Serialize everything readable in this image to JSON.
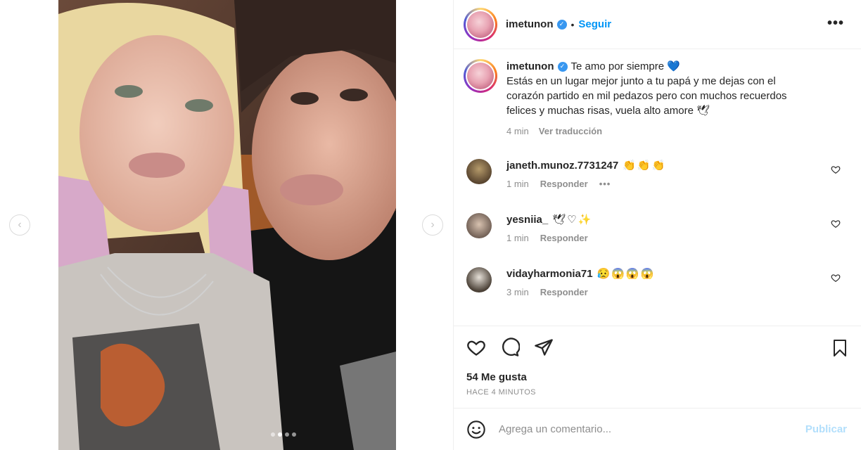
{
  "post": {
    "username": "imetunon",
    "separator": "•",
    "follow_label": "Seguir",
    "more_label": "•••",
    "verified_symbol": "✓"
  },
  "caption": {
    "username": "imetunon",
    "first_line": "Te amo por siempre",
    "heart_emoji": "💙",
    "line2": "Estás en un lugar mejor junto a tu papá y me dejas con el",
    "line3": "corazón partido en mil pedazos pero con muchos recuerdos",
    "line4": "felices y muchas risas, vuela alto amore",
    "line4_emoji": "🕊",
    "time": "4 min",
    "translate_label": "Ver traducción"
  },
  "comments": [
    {
      "username": "janeth.munoz.7731247",
      "emoji": "👏👏👏",
      "time": "1 min",
      "reply_label": "Responder",
      "more": "•••"
    },
    {
      "username": "yesniia_",
      "emoji": "🕊♡✨",
      "time": "1 min",
      "reply_label": "Responder"
    },
    {
      "username": "vidayharmonia71",
      "emoji": "😥😱😱😱",
      "time": "3 min",
      "reply_label": "Responder"
    }
  ],
  "engagement": {
    "likes": "54 Me gusta",
    "timestamp": "HACE 4 MINUTOS"
  },
  "comment_box": {
    "placeholder": "Agrega un comentario...",
    "publish_label": "Publicar"
  },
  "media": {
    "prev_label": "‹",
    "next_label": "›",
    "slide_count": 4,
    "active_slide": 2
  },
  "colors": {
    "accent": "#0095f6",
    "verified": "#3897f0",
    "publish_disabled": "#b2dffc",
    "muted": "#8e8e8e"
  }
}
